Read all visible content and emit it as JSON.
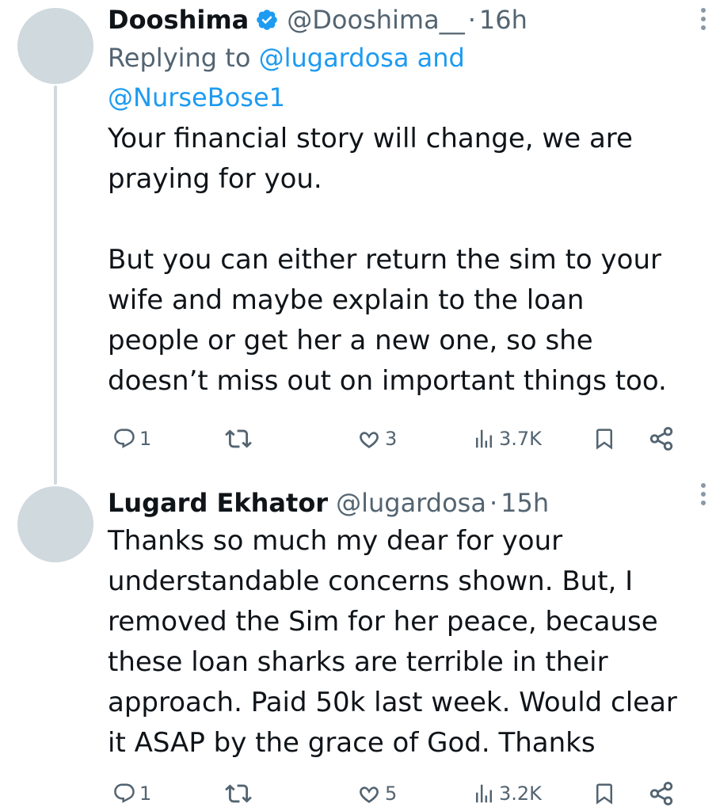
{
  "tweets": [
    {
      "name": "Dooshima",
      "verified": true,
      "handle": "@Dooshima__",
      "dot": "·",
      "time": "16h",
      "replying_prefix": "Replying to ",
      "replying_mention_1": "@lugardosa",
      "replying_and": " and ",
      "replying_mention_2": "@NurseBose1",
      "text": "Your financial story will change, we are praying for you.\n\nBut you can either return the sim to your wife and maybe explain to the loan people or get her a new one, so she doesn’t miss out on important things too.",
      "replies": "1",
      "retweets": "",
      "likes": "3",
      "views": "3.7K"
    },
    {
      "name": "Lugard Ekhator",
      "verified": false,
      "handle": "@lugardosa",
      "dot": "·",
      "time": "15h",
      "text": "Thanks so much my dear for your understandable concerns shown. But, I removed the Sim for her peace, because these loan sharks are terrible in their approach. Paid 50k last week. Would clear it ASAP by the grace of God. Thanks",
      "replies": "1",
      "retweets": "",
      "likes": "5",
      "views": "3.2K"
    }
  ],
  "icons": {
    "verified": "verified-badge-icon",
    "more": "more-vertical-icon",
    "reply": "reply-icon",
    "retweet": "retweet-icon",
    "like": "heart-icon",
    "views": "views-icon",
    "bookmark": "bookmark-icon",
    "share": "share-icon"
  },
  "colors": {
    "text": "#0f1419",
    "secondary": "#536471",
    "link": "#1d9bf0",
    "avatar_placeholder": "#cfd9de",
    "thread_line": "#cfd9de"
  }
}
